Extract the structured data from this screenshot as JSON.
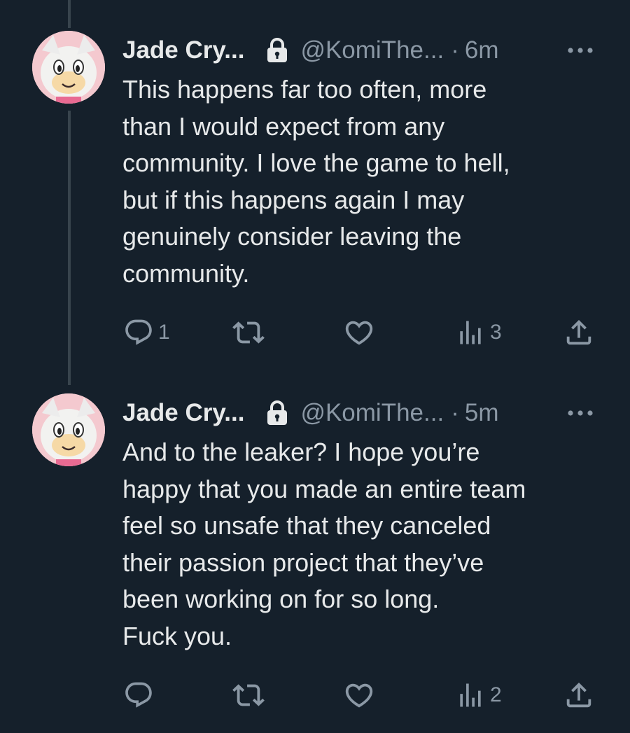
{
  "theme": {
    "background": "#15202b",
    "text": "#e7e9ea",
    "secondary": "#8b98a5",
    "thread_line": "#38444d"
  },
  "tweets": [
    {
      "display_name": "Jade Cry...",
      "handle": "@KomiThe...",
      "separator": "·",
      "time": "6m",
      "protected": true,
      "text": "This happens far too often, more\nthan I would expect from any\ncommunity. I love the game to hell,\nbut if this happens again I may\ngenuinely consider leaving the\ncommunity.",
      "replies": "1",
      "views": "3"
    },
    {
      "display_name": "Jade Cry...",
      "handle": "@KomiThe...",
      "separator": "·",
      "time": "5m",
      "protected": true,
      "text": "And to the leaker? I hope you’re\nhappy that you made an entire team\nfeel so unsafe that they canceled\ntheir passion project that they’ve\nbeen working on for so long.\nFuck you.",
      "replies": "",
      "views": "2"
    }
  ],
  "icons": {
    "avatar": "cartoon-hedgehog-avatar",
    "lock": "lock-icon",
    "more": "more-options-icon",
    "reply": "reply-bubble-icon",
    "retweet": "retweet-icon",
    "like": "heart-icon",
    "views": "views-bar-chart-icon",
    "share": "share-upload-icon"
  }
}
